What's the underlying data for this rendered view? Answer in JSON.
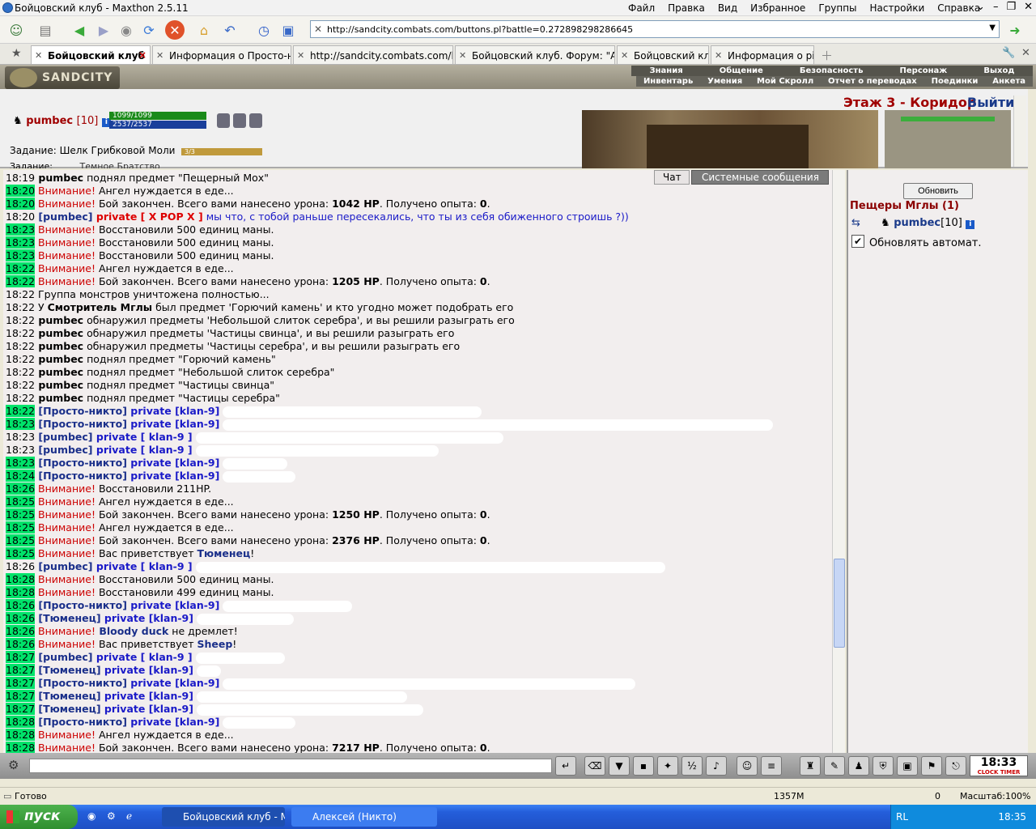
{
  "window": {
    "title": "Бойцовский клуб - Maxthon 2.5.11",
    "menu": [
      "Файл",
      "Правка",
      "Вид",
      "Избранное",
      "Группы",
      "Настройки",
      "Справка"
    ]
  },
  "address": {
    "url": "http://sandcity.combats.com/buttons.pl?battle=0.272898298286645"
  },
  "tabs": [
    {
      "label": "Бойцовский клуб"
    },
    {
      "label": "Информация о Просто-никто"
    },
    {
      "label": "http://sandcity.combats.com/log..."
    },
    {
      "label": "Бойцовский клуб. Форум: \"Адм..."
    },
    {
      "label": "Бойцовский клуб"
    },
    {
      "label": "Информация о pizec"
    }
  ],
  "game": {
    "logo": "SANDCITY",
    "nav_top": [
      "Знания",
      "Общение",
      "Безопасность",
      "Персонаж",
      "Выход"
    ],
    "nav_bottom": [
      "Инвентарь",
      "Умения",
      "Мой Скролл",
      "Отчет о переводах",
      "Поединки",
      "Анкета"
    ],
    "player": {
      "name": "pumbec",
      "level": "[10]",
      "hp": "1099/1099",
      "mana": "2537/2537"
    },
    "quest": {
      "label": "Задание: Шелк Грибковой Моли",
      "progress": "3/3",
      "label2": "Задание:",
      "extra": "Темное Братство"
    },
    "location": "Этаж 3 - Коридор",
    "exit": "Выйти"
  },
  "chat": {
    "tab_chat": "Чат",
    "tab_system": "Системные сообщения",
    "lines": [
      [
        [
          "t",
          "18:19"
        ],
        [
          "b",
          " pumbec"
        ],
        [
          "n",
          " поднял предмет \"Пещерный Мох\""
        ]
      ],
      [
        [
          "tg",
          "18:20"
        ],
        [
          "w",
          " Внимание!"
        ],
        [
          "n",
          " Ангел нуждается в еде..."
        ]
      ],
      [
        [
          "tg",
          "18:20"
        ],
        [
          "w",
          " Внимание!"
        ],
        [
          "n",
          " Бой закончен. Всего вами нанесено урона: "
        ],
        [
          "b",
          "1042 HP"
        ],
        [
          "n",
          ". Получено опыта: "
        ],
        [
          "b",
          "0"
        ],
        [
          "n",
          "."
        ]
      ],
      [
        [
          "t",
          "18:20"
        ],
        [
          "nm",
          " [pumbec]"
        ],
        [
          "pvr",
          " private [ X POP X ]"
        ],
        [
          "mp",
          " мы что, с тобой раньше пересекались, что ты из себя обиженного строишь ?))"
        ]
      ],
      [
        [
          "tg",
          "18:23"
        ],
        [
          "w",
          " Внимание!"
        ],
        [
          "n",
          " Восстановили 500 единиц маны."
        ]
      ],
      [
        [
          "tg",
          "18:23"
        ],
        [
          "w",
          " Внимание!"
        ],
        [
          "n",
          " Восстановили 500 единиц маны."
        ]
      ],
      [
        [
          "tg",
          "18:23"
        ],
        [
          "w",
          " Внимание!"
        ],
        [
          "n",
          " Восстановили 500 единиц маны."
        ]
      ],
      [
        [
          "tg",
          "18:22"
        ],
        [
          "w",
          " Внимание!"
        ],
        [
          "n",
          " Ангел нуждается в еде..."
        ]
      ],
      [
        [
          "tg",
          "18:22"
        ],
        [
          "w",
          " Внимание!"
        ],
        [
          "n",
          " Бой закончен. Всего вами нанесено урона: "
        ],
        [
          "b",
          "1205 HP"
        ],
        [
          "n",
          ". Получено опыта: "
        ],
        [
          "b",
          "0"
        ],
        [
          "n",
          "."
        ]
      ],
      [
        [
          "t",
          "18:22"
        ],
        [
          "n",
          " Группа монстров уничтожена полностью..."
        ]
      ],
      [
        [
          "t",
          "18:22"
        ],
        [
          "n",
          " У "
        ],
        [
          "b",
          "Смотритель Мглы"
        ],
        [
          "n",
          " был предмет 'Горючий камень' и кто угодно может подобрать его"
        ]
      ],
      [
        [
          "t",
          "18:22"
        ],
        [
          "b",
          " pumbec"
        ],
        [
          "n",
          " обнаружил предметы 'Небольшой слиток серебра', и вы решили разыграть его"
        ]
      ],
      [
        [
          "t",
          "18:22"
        ],
        [
          "b",
          " pumbec"
        ],
        [
          "n",
          " обнаружил предметы 'Частицы свинца', и вы решили разыграть его"
        ]
      ],
      [
        [
          "t",
          "18:22"
        ],
        [
          "b",
          " pumbec"
        ],
        [
          "n",
          " обнаружил предметы 'Частицы серебра', и вы решили разыграть его"
        ]
      ],
      [
        [
          "t",
          "18:22"
        ],
        [
          "b",
          " pumbec"
        ],
        [
          "n",
          " поднял предмет \"Горючий камень\""
        ]
      ],
      [
        [
          "t",
          "18:22"
        ],
        [
          "b",
          " pumbec"
        ],
        [
          "n",
          " поднял предмет \"Небольшой слиток серебра\""
        ]
      ],
      [
        [
          "t",
          "18:22"
        ],
        [
          "b",
          " pumbec"
        ],
        [
          "n",
          " поднял предмет \"Частицы свинца\""
        ]
      ],
      [
        [
          "t",
          "18:22"
        ],
        [
          "b",
          " pumbec"
        ],
        [
          "n",
          " поднял предмет \"Частицы серебра\""
        ]
      ],
      [
        [
          "tg",
          "18:22"
        ],
        [
          "nm",
          " [Просто-никто]"
        ],
        [
          "pv",
          " private [klan-9]"
        ],
        [
          "x",
          "320"
        ]
      ],
      [
        [
          "tg",
          "18:23"
        ],
        [
          "nm",
          " [Просто-никто]"
        ],
        [
          "pv",
          " private [klan-9]"
        ],
        [
          "x",
          "680"
        ]
      ],
      [
        [
          "t",
          "18:23"
        ],
        [
          "nm",
          " [pumbec]"
        ],
        [
          "pv",
          " private [ klan-9 ]"
        ],
        [
          "x",
          "380"
        ]
      ],
      [
        [
          "t",
          "18:23"
        ],
        [
          "nm",
          " [pumbec]"
        ],
        [
          "pv",
          " private [ klan-9 ]"
        ],
        [
          "x",
          "300"
        ]
      ],
      [
        [
          "tg",
          "18:23"
        ],
        [
          "nm",
          " [Просто-никто]"
        ],
        [
          "pv",
          " private [klan-9]"
        ],
        [
          "x",
          "80"
        ]
      ],
      [
        [
          "tg",
          "18:24"
        ],
        [
          "nm",
          " [Просто-никто]"
        ],
        [
          "pv",
          " private [klan-9]"
        ],
        [
          "x",
          "90"
        ]
      ],
      [
        [
          "tg",
          "18:26"
        ],
        [
          "w",
          " Внимание!"
        ],
        [
          "n",
          " Восстановили 211HP."
        ]
      ],
      [
        [
          "tg",
          "18:25"
        ],
        [
          "w",
          " Внимание!"
        ],
        [
          "n",
          " Ангел нуждается в еде..."
        ]
      ],
      [
        [
          "tg",
          "18:25"
        ],
        [
          "w",
          " Внимание!"
        ],
        [
          "n",
          " Бой закончен. Всего вами нанесено урона: "
        ],
        [
          "b",
          "1250 HP"
        ],
        [
          "n",
          ". Получено опыта: "
        ],
        [
          "b",
          "0"
        ],
        [
          "n",
          "."
        ]
      ],
      [
        [
          "tg",
          "18:25"
        ],
        [
          "w",
          " Внимание!"
        ],
        [
          "n",
          " Ангел нуждается в еде..."
        ]
      ],
      [
        [
          "tg",
          "18:25"
        ],
        [
          "w",
          " Внимание!"
        ],
        [
          "n",
          " Бой закончен. Всего вами нанесено урона: "
        ],
        [
          "b",
          "2376 HP"
        ],
        [
          "n",
          ". Получено опыта: "
        ],
        [
          "b",
          "0"
        ],
        [
          "n",
          "."
        ]
      ],
      [
        [
          "tg",
          "18:25"
        ],
        [
          "w",
          " Внимание!"
        ],
        [
          "n",
          " Вас приветствует "
        ],
        [
          "nm",
          "Тюменец"
        ],
        [
          "n",
          "!"
        ]
      ],
      [
        [
          "t",
          "18:26"
        ],
        [
          "nm",
          " [pumbec]"
        ],
        [
          "pv",
          " private [ klan-9 ]"
        ],
        [
          "x",
          "580"
        ]
      ],
      [
        [
          "tg",
          "18:28"
        ],
        [
          "w",
          " Внимание!"
        ],
        [
          "n",
          " Восстановили 500 единиц маны."
        ]
      ],
      [
        [
          "tg",
          "18:28"
        ],
        [
          "w",
          " Внимание!"
        ],
        [
          "n",
          " Восстановили 499 единиц маны."
        ]
      ],
      [
        [
          "tg",
          "18:26"
        ],
        [
          "nm",
          " [Просто-никто]"
        ],
        [
          "pv",
          " private [klan-9]"
        ],
        [
          "x",
          "160"
        ]
      ],
      [
        [
          "tg",
          "18:26"
        ],
        [
          "nm",
          " [Тюменец]"
        ],
        [
          "pv",
          " private [klan-9]"
        ],
        [
          "x",
          "120"
        ]
      ],
      [
        [
          "tg",
          "18:26"
        ],
        [
          "w",
          " Внимание!"
        ],
        [
          "nm",
          " Bloody duck"
        ],
        [
          "n",
          " не дремлет!"
        ]
      ],
      [
        [
          "tg",
          "18:26"
        ],
        [
          "w",
          " Внимание!"
        ],
        [
          "n",
          " Вас приветствует "
        ],
        [
          "nm",
          "Sheep"
        ],
        [
          "n",
          "!"
        ]
      ],
      [
        [
          "tg",
          "18:27"
        ],
        [
          "nm",
          " [pumbec]"
        ],
        [
          "pv",
          " private [ klan-9 ]"
        ],
        [
          "x",
          "110"
        ]
      ],
      [
        [
          "tg",
          "18:27"
        ],
        [
          "nm",
          " [Тюменец]"
        ],
        [
          "pv",
          " private [klan-9]"
        ],
        [
          "x",
          "30"
        ]
      ],
      [
        [
          "tg",
          "18:27"
        ],
        [
          "nm",
          " [Просто-никто]"
        ],
        [
          "pv",
          " private [klan-9]"
        ],
        [
          "x",
          "510"
        ]
      ],
      [
        [
          "tg",
          "18:27"
        ],
        [
          "nm",
          " [Тюменец]"
        ],
        [
          "pv",
          " private [klan-9]"
        ],
        [
          "x",
          "260"
        ]
      ],
      [
        [
          "tg",
          "18:27"
        ],
        [
          "nm",
          " [Тюменец]"
        ],
        [
          "pv",
          " private [klan-9]"
        ],
        [
          "x",
          "280"
        ]
      ],
      [
        [
          "tg",
          "18:28"
        ],
        [
          "nm",
          " [Просто-никто]"
        ],
        [
          "pv",
          " private [klan-9]"
        ],
        [
          "x",
          "90"
        ]
      ],
      [
        [
          "tg",
          "18:28"
        ],
        [
          "w",
          " Внимание!"
        ],
        [
          "n",
          " Ангел нуждается в еде..."
        ]
      ],
      [
        [
          "tg",
          "18:28"
        ],
        [
          "w",
          " Внимание!"
        ],
        [
          "n",
          " Бой закончен. Всего вами нанесено урона: "
        ],
        [
          "b",
          "7217 HP"
        ],
        [
          "n",
          ". Получено опыта: "
        ],
        [
          "b",
          "0"
        ],
        [
          "n",
          "."
        ]
      ]
    ]
  },
  "sidebar": {
    "refresh": "Обновить",
    "cave": "Пещеры Мглы (1)",
    "player": "pumbec",
    "player_level": "[10]",
    "auto": "Обновлять автомат."
  },
  "clock": {
    "time": "18:33",
    "label": "CLOCK TIMER"
  },
  "status": {
    "text": "Готово",
    "mem": "1357M",
    "count": "0",
    "zoom": "Масштаб:100%"
  },
  "taskbar": {
    "start": "пуск",
    "tasks": [
      "Бойцовский клуб - M...",
      "Алексей (Никто)"
    ],
    "lang": "RL",
    "time": "18:35"
  }
}
